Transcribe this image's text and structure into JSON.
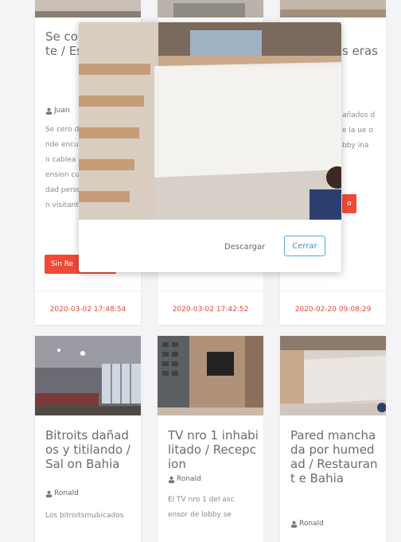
{
  "cards": [
    {
      "title": "Se co band prote / Esto mien",
      "author": "Juan",
      "description": "Se cero donde encuen cablea tension cuidad person visitant",
      "status_label": "Sin Re",
      "date": "2020-03-02 17:48:54"
    },
    {
      "date": "2020-03-02 17:42:52"
    },
    {
      "title": "s eras",
      "description": "añados de la ue obby ina",
      "status_label": "o",
      "date": "2020-02-20 09:08:29"
    },
    {
      "title": "Bitroits dañados y titilando / Sal on Bahia",
      "author": "Ronald",
      "description": "Los bitroitsmubicados"
    },
    {
      "title": "TV nro 1 inhabilitado / Recepcion",
      "author": "Ronald",
      "description": "El TV nro 1 del ascensor de lobby se"
    },
    {
      "title": "Pared manchada por humedad / Restaurant e Bahia",
      "author": "Ronald"
    }
  ],
  "modal": {
    "download_label": "Descargar",
    "close_label": "Cerrar"
  },
  "colors": {
    "accent_red": "#f04a36",
    "date_red": "#e8473a",
    "close_blue": "#3f8fc8"
  },
  "icons": {
    "author": "user-icon"
  }
}
